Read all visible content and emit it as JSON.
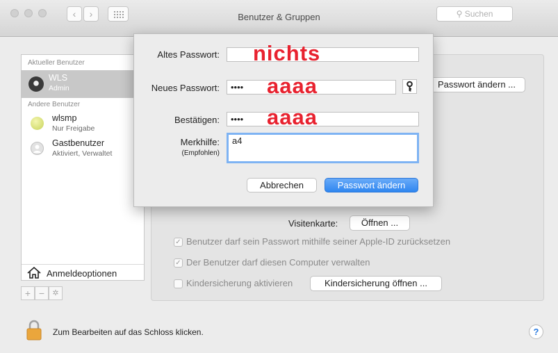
{
  "window": {
    "title": "Benutzer & Gruppen",
    "search_placeholder": "Suchen"
  },
  "sidebar": {
    "current_header": "Aktueller Benutzer",
    "current_user": {
      "name": "WLS",
      "role": "Admin"
    },
    "others_header": "Andere Benutzer",
    "other_users": [
      {
        "name": "wlsmp",
        "role": "Nur Freigabe"
      },
      {
        "name": "Gastbenutzer",
        "role": "Aktiviert, Verwaltet"
      }
    ],
    "login_options": "Anmeldeoptionen",
    "add_symbol": "+",
    "remove_symbol": "−",
    "gear_symbol": "✲"
  },
  "main": {
    "change_password_button": "Passwort ändern ...",
    "contact_label": "Visitenkarte:",
    "open_button": "Öffnen ...",
    "checkboxes": [
      {
        "label": "Benutzer darf sein Passwort mithilfe seiner Apple-ID zurücksetzen",
        "checked": true
      },
      {
        "label": "Der Benutzer darf diesen Computer verwalten",
        "checked": true
      },
      {
        "label": "Kindersicherung aktivieren",
        "checked": false
      }
    ],
    "parental_button": "Kindersicherung öffnen ..."
  },
  "footer": {
    "lock_text": "Zum Bearbeiten auf das Schloss klicken.",
    "help": "?"
  },
  "sheet": {
    "old_label": "Altes Passwort:",
    "old_value": "",
    "new_label": "Neues Passwort:",
    "new_value": "••••",
    "confirm_label": "Bestätigen:",
    "confirm_value": "••••",
    "hint_label": "Merkhilfe:",
    "hint_sub": "(Empfohlen)",
    "hint_value": "a4",
    "cancel_button": "Abbrechen",
    "ok_button": "Passwort ändern",
    "accent_color": "#3b8ef0"
  },
  "annotations": {
    "old": "nichts",
    "new": "aaaa",
    "confirm": "aaaa",
    "color": "#e8222f"
  }
}
